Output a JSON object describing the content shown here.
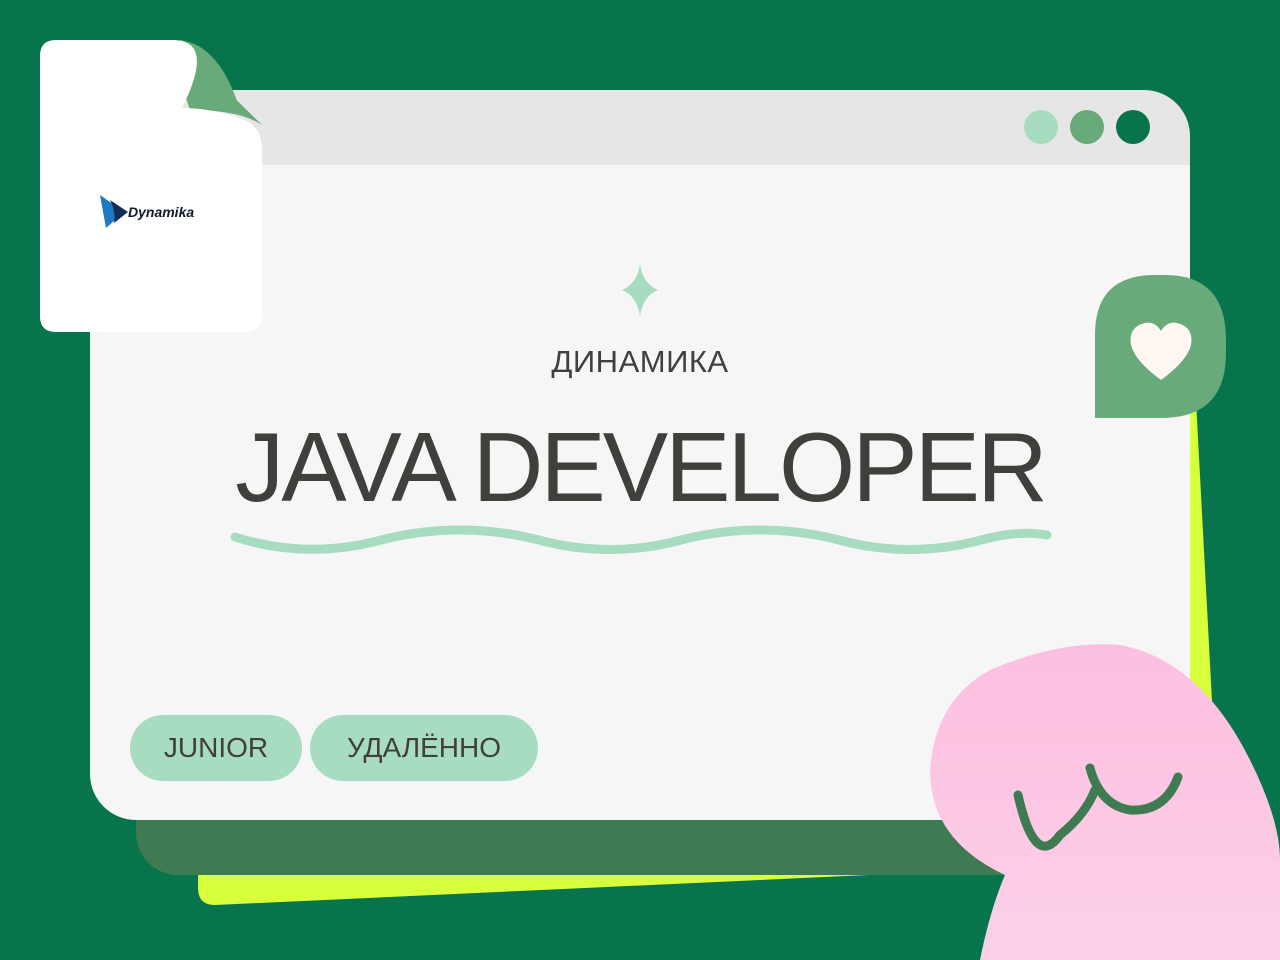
{
  "colors": {
    "background": "#08744C",
    "window_shadow": "#3E7B52",
    "accent_lime": "#D7FF3C",
    "window_body": "#F6F6F6",
    "titlebar": "#E6E6E6",
    "mint": "#A8DCC0",
    "mid_green": "#68AA7A",
    "dark_green": "#08744C",
    "text_dark": "#3F3F3C",
    "pink": "#FDBFE0",
    "pink_light": "#FCD0E8",
    "heart": "#FFF8F2",
    "logo_blue": "#1E78C2",
    "logo_navy": "#0F2E52",
    "logo_text": "#0E1B2C"
  },
  "logo": {
    "text": "Dynamika"
  },
  "company": "ДИНАМИКА",
  "title": "JAVA DEVELOPER",
  "tags": [
    "JUNIOR",
    "УДАЛЁННО"
  ],
  "icons": {
    "sparkle": "sparkle-icon",
    "heart": "heart-icon",
    "mascot": "pink-blob-mascot"
  }
}
